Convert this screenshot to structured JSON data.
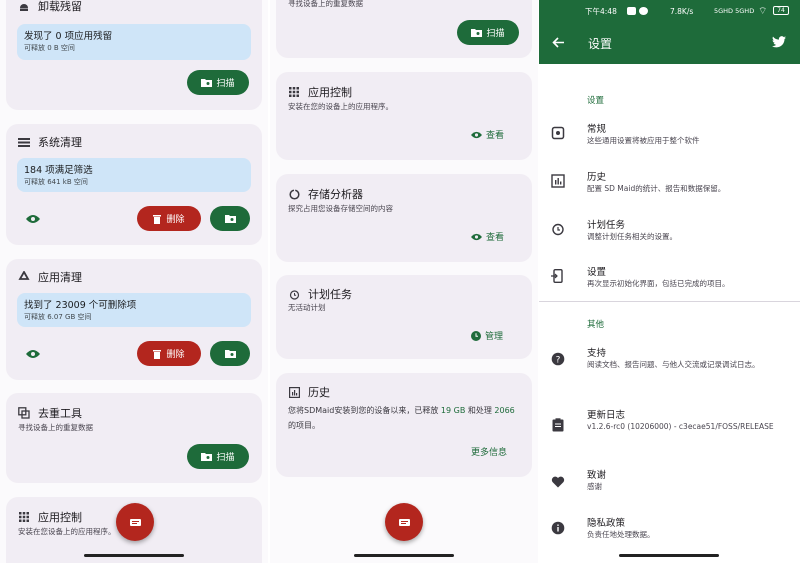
{
  "panel1": {
    "uninstall_card": {
      "title": "卸载残留",
      "info_main": "发现了 0 项应用残留",
      "info_sub": "可释放 0 B 空间",
      "scan_label": "扫描"
    },
    "system_clean_card": {
      "title": "系统清理",
      "info_main": "184 项满足筛选",
      "info_sub": "可释放 641 kB 空间",
      "delete_label": "删除"
    },
    "app_clean_card": {
      "title": "应用清理",
      "info_main": "找到了 23009 个可删除项",
      "info_sub": "可释放 6.07 GB 空间",
      "delete_label": "删除"
    },
    "dedupe_card": {
      "title": "去重工具",
      "desc": "寻找设备上的重复数据",
      "scan_label": "扫描"
    },
    "app_control_card": {
      "title": "应用控制",
      "desc": "安装在您设备上的应用程序。"
    }
  },
  "panel2": {
    "top_card": {
      "desc": "寻找设备上的重复数据",
      "scan_label": "扫描"
    },
    "app_control_card": {
      "title": "应用控制",
      "desc": "安装在您的设备上的应用程序。",
      "view_label": "查看"
    },
    "storage_card": {
      "title": "存储分析器",
      "desc": "探究占用您设备存储空间的内容",
      "view_label": "查看"
    },
    "scheduler_card": {
      "title": "计划任务",
      "desc": "无活动计划",
      "manage_label": "管理"
    },
    "history_card": {
      "title": "历史",
      "desc_pre": "您将SDMaid安装到您的设备以来，已释放",
      "freed": "19 GB",
      "desc_mid": "和处理",
      "count": "2066",
      "desc_post": "的项目。",
      "more_label": "更多信息"
    }
  },
  "panel3": {
    "status": {
      "time": "下午4:48",
      "speed": "7.8K/s",
      "signal": "5GHD 5GHD",
      "battery": "74"
    },
    "toolbar": {
      "title": "设置"
    },
    "section_settings": "设置",
    "items": [
      {
        "title": "常规",
        "sub": "这些通用设置将被应用于整个软件"
      },
      {
        "title": "历史",
        "sub": "配置 SD Maid的统计、报告和数据保留。"
      },
      {
        "title": "计划任务",
        "sub": "调整计划任务相关的设置。"
      },
      {
        "title": "设置",
        "sub": "再次显示初始化界面，包括已完成的项目。"
      }
    ],
    "section_other": "其他",
    "other_items": [
      {
        "title": "支持",
        "sub": "阅读文档、报告问题、与他人交流或记录调试日志。"
      },
      {
        "title": "更新日志",
        "sub": "v1.2.6-rc0 (10206000) - c3ecae51/FOSS/RELEASE"
      },
      {
        "title": "致谢",
        "sub": "感谢"
      },
      {
        "title": "隐私政策",
        "sub": "负责任地处理数据。"
      }
    ]
  },
  "colors": {
    "green": "#1e6b3a",
    "red": "#b3261e",
    "info_blue": "#cfe5f8",
    "card": "#f1edf4"
  }
}
